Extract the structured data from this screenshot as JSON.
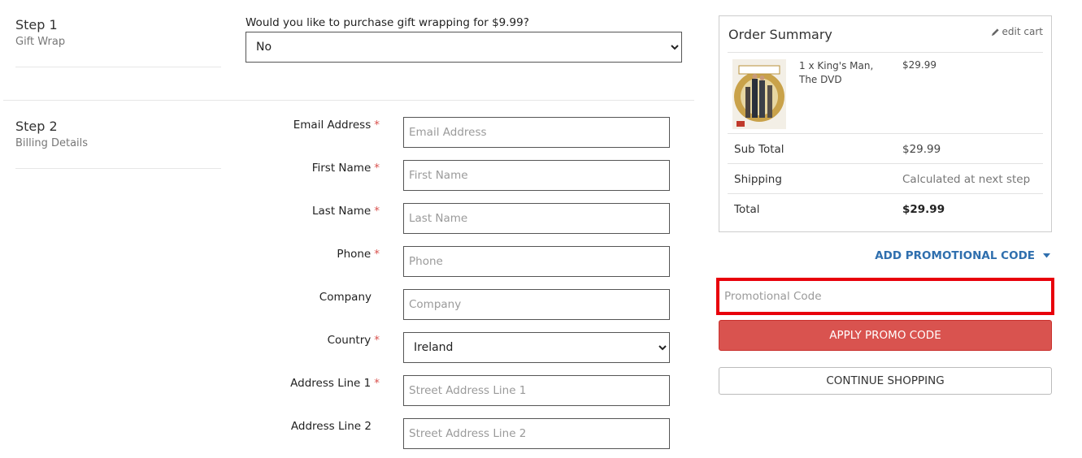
{
  "step1": {
    "title": "Step 1",
    "subtitle": "Gift Wrap",
    "question": "Would you like to purchase gift wrapping for $9.99?",
    "selected": "No"
  },
  "step2": {
    "title": "Step 2",
    "subtitle": "Billing Details",
    "required_marker": "*",
    "fields": {
      "email": {
        "label": "Email Address",
        "placeholder": "Email Address",
        "value": ""
      },
      "first_name": {
        "label": "First Name",
        "placeholder": "First Name",
        "value": ""
      },
      "last_name": {
        "label": "Last Name",
        "placeholder": "Last Name",
        "value": ""
      },
      "phone": {
        "label": "Phone",
        "placeholder": "Phone",
        "value": ""
      },
      "company": {
        "label": "Company",
        "placeholder": "Company",
        "value": ""
      },
      "country": {
        "label": "Country",
        "selected": "Ireland"
      },
      "address1": {
        "label": "Address Line 1",
        "placeholder": "Street Address Line 1",
        "value": ""
      },
      "address2": {
        "label": "Address Line 2",
        "placeholder": "Street Address Line 2",
        "value": ""
      }
    }
  },
  "summary": {
    "title": "Order Summary",
    "edit_cart": "edit cart",
    "item": {
      "name": "1 x King's Man, The DVD",
      "price": "$29.99",
      "thumb_icon": "dvd-cover"
    },
    "subtotal": {
      "label": "Sub Total",
      "value": "$29.99"
    },
    "shipping": {
      "label": "Shipping",
      "value": "Calculated at next step"
    },
    "total": {
      "label": "Total",
      "value": "$29.99"
    }
  },
  "promo": {
    "toggle_label": "ADD PROMOTIONAL CODE",
    "placeholder": "Promotional Code",
    "value": "",
    "apply_label": "APPLY PROMO CODE",
    "continue_label": "CONTINUE SHOPPING"
  },
  "colors": {
    "accent_red": "#d9534f",
    "link_blue": "#2f6fae",
    "highlight": "#e8000b"
  }
}
